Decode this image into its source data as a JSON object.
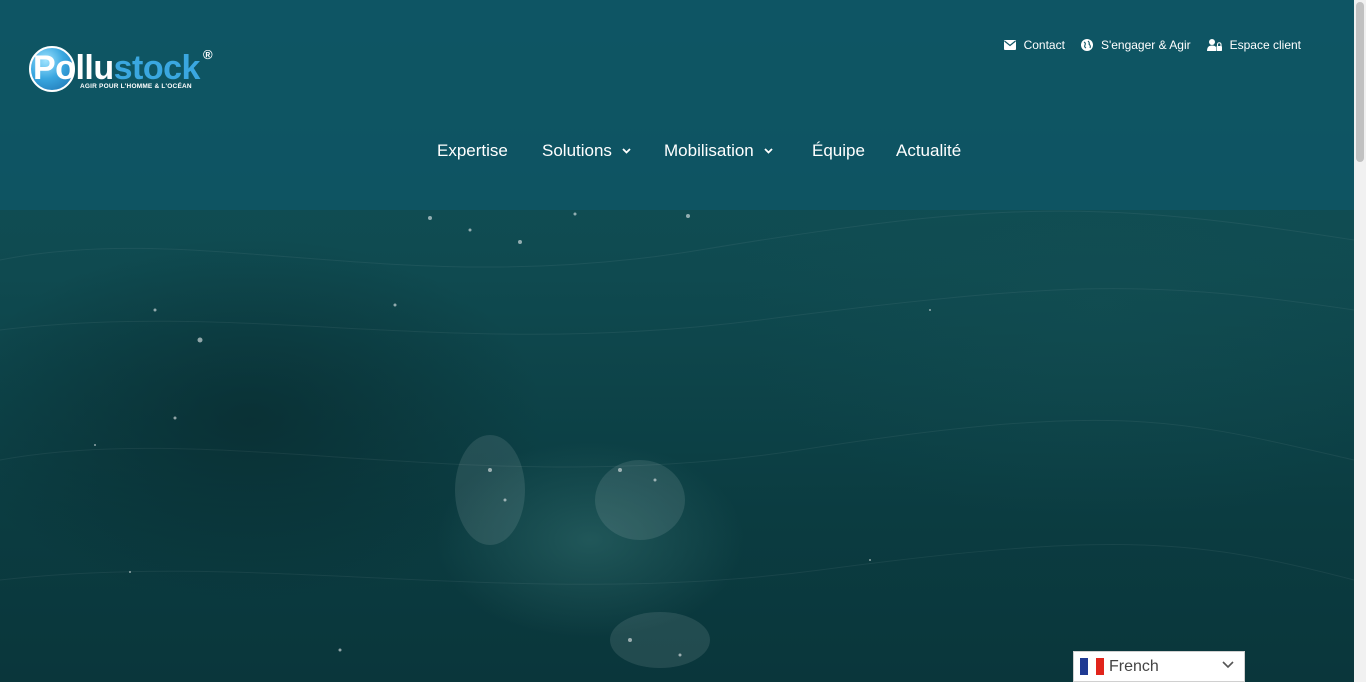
{
  "brand": {
    "logo_text_white": "Po",
    "logo_text_rest": "llu",
    "logo_text_accent": "stock",
    "registered_mark": "®",
    "tagline": "AGIR POUR L'HOMME & L'OCÉAN"
  },
  "top_links": [
    {
      "label": "Contact",
      "icon": "envelope-icon"
    },
    {
      "label": "S'engager & Agir",
      "icon": "globe-icon"
    },
    {
      "label": "Espace client",
      "icon": "user-lock-icon"
    }
  ],
  "main_nav": [
    {
      "label": "Expertise",
      "has_dropdown": false
    },
    {
      "label": "Solutions",
      "has_dropdown": true
    },
    {
      "label": "Mobilisation",
      "has_dropdown": true
    },
    {
      "label": "Équipe",
      "has_dropdown": false
    },
    {
      "label": "Actualité",
      "has_dropdown": false
    }
  ],
  "language_selector": {
    "selected": "French",
    "flag_colors": [
      "#1f3a93",
      "#ffffff",
      "#e1241b"
    ]
  },
  "colors": {
    "header_overlay": "#0e5666",
    "ocean": "#0f4a50",
    "logo_accent": "#3aa7e0"
  }
}
